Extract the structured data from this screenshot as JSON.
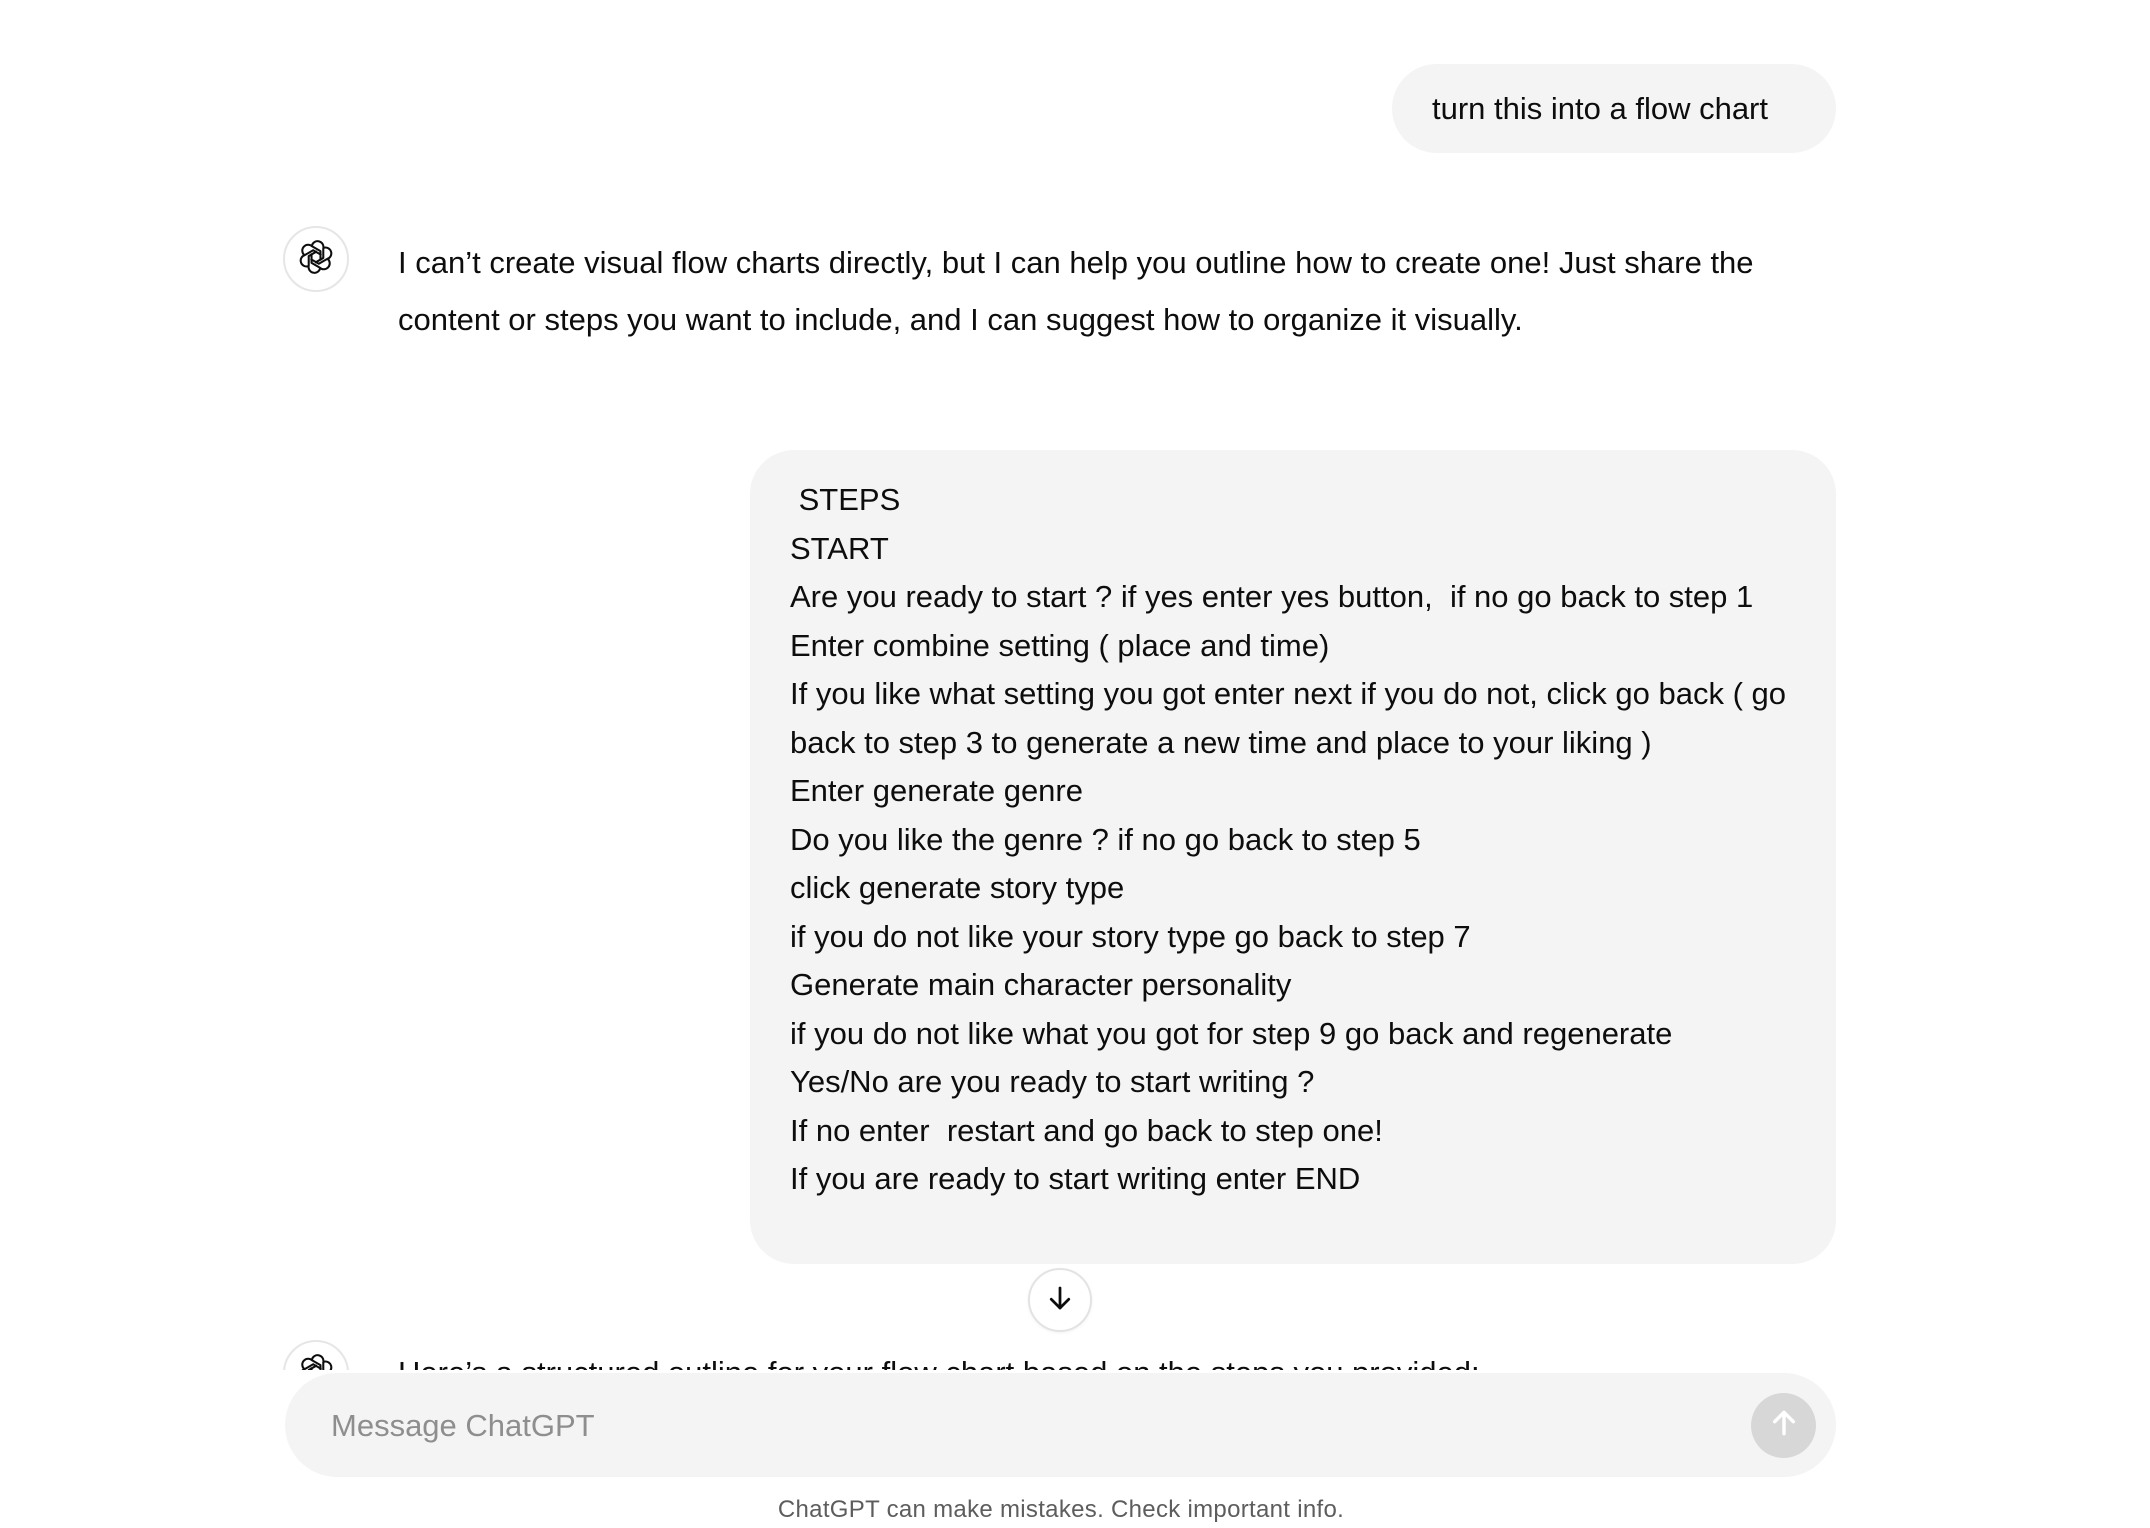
{
  "conversation": {
    "user_message_1": "turn this into a flow chart",
    "assistant_message_1": "I can’t create visual flow charts directly, but I can help you outline how to create one! Just share the content or steps you want to include, and I can suggest how to organize it visually.",
    "user_message_2_lines": [
      " STEPS",
      "START",
      "Are you ready to start ? if yes enter yes button,  if no go back to step 1",
      "Enter combine setting ( place and time)",
      "If you like what setting you got enter next if you do not, click go back ( go back to step 3 to generate a new time and place to your liking )",
      "Enter generate genre",
      "Do you like the genre ? if no go back to step 5",
      "click generate story type",
      "if you do not like your story type go back to step 7",
      "Generate main character personality",
      "if you do not like what you got for step 9 go back and regenerate",
      "Yes/No are you ready to start writing ?",
      "If no enter  restart and go back to step one!",
      "If you are ready to start writing enter END"
    ],
    "assistant_message_2": "Here’s a structured outline for your flow chart based on the steps you provided:"
  },
  "icons": {
    "assistant_avatar": "openai-logo-icon",
    "scroll_down": "arrow-down-icon",
    "send": "arrow-up-icon"
  },
  "composer": {
    "placeholder": "Message ChatGPT",
    "value": ""
  },
  "footer": {
    "disclaimer": "ChatGPT can make mistakes. Check important info."
  },
  "colors": {
    "bubble_bg": "#f4f4f4",
    "text": "#0d0d0d",
    "placeholder": "#8e8e8e",
    "send_button_disabled": "#d7d7d7",
    "disclaimer": "#5d5d5d"
  }
}
